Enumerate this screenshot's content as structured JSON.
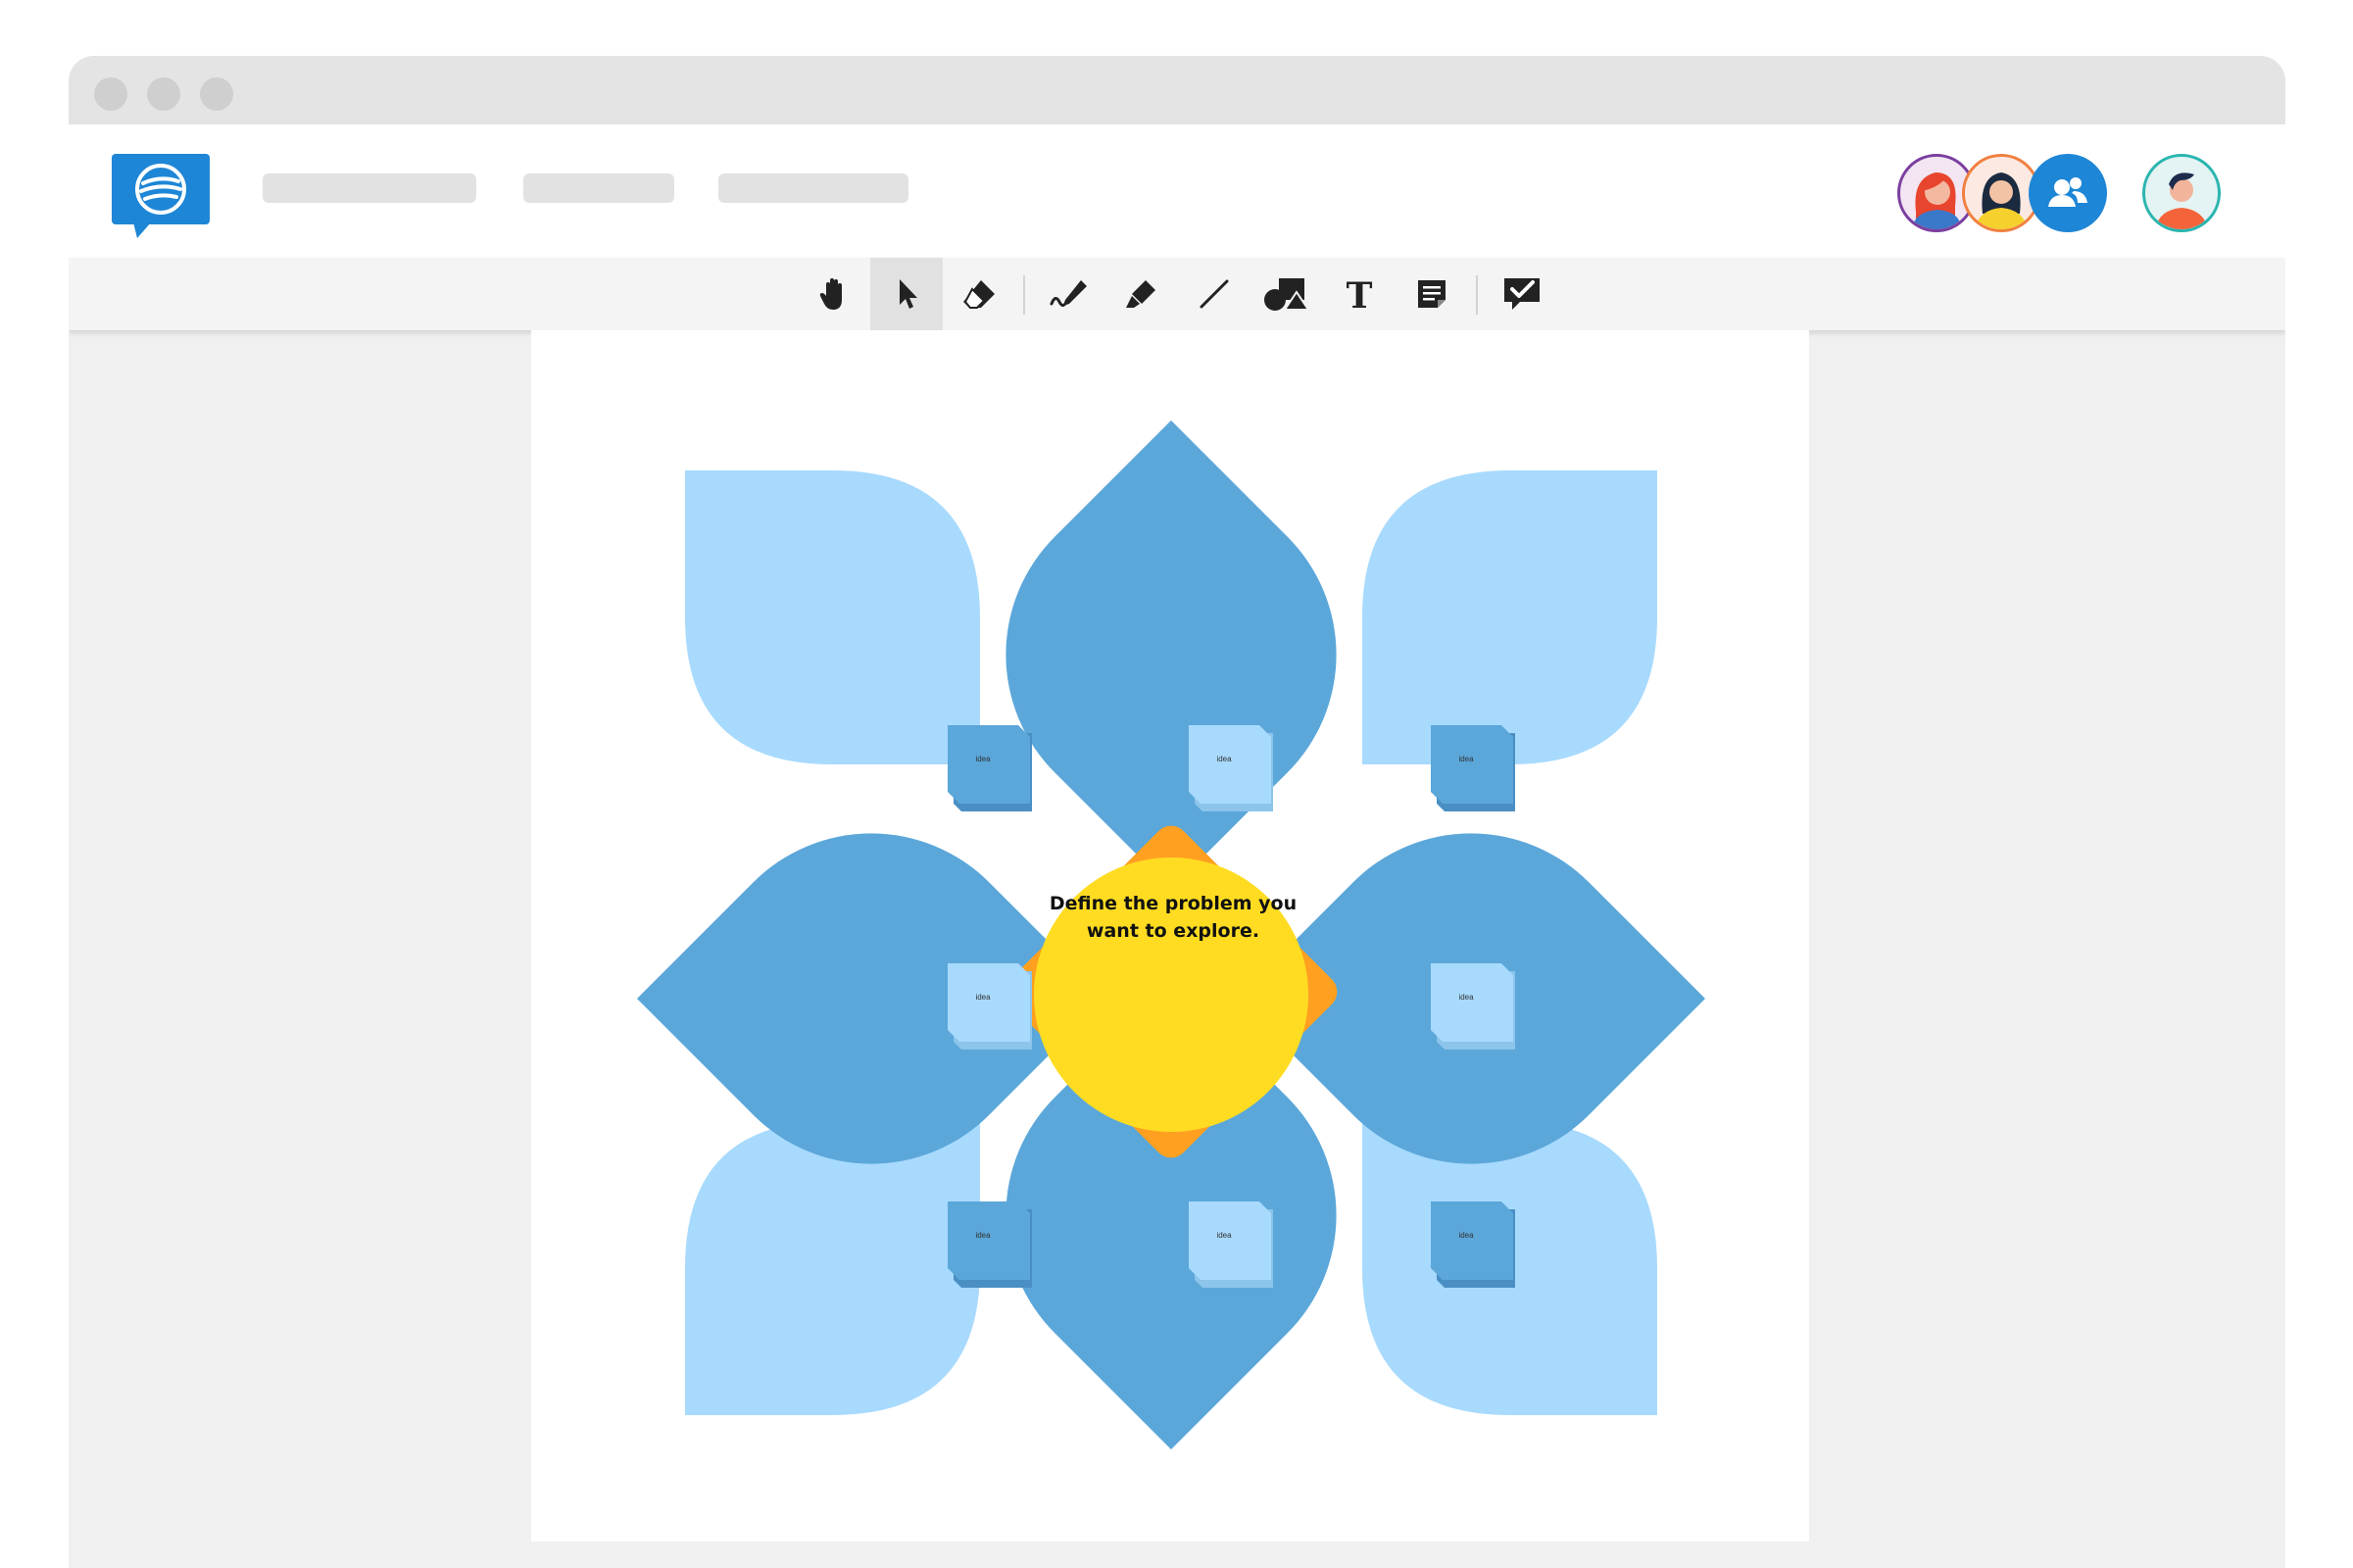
{
  "app": {
    "brand_color": "#1e86d6",
    "logo_icon": "chat-bubble-logo-icon"
  },
  "collaborators": [
    {
      "name": "collaborator-avatar-1",
      "ring": "#7b3fa0"
    },
    {
      "name": "collaborator-avatar-2",
      "ring": "#f08040"
    },
    {
      "name": "participants-icon",
      "ring": "#1e86d6"
    },
    {
      "name": "current-user-avatar",
      "ring": "#2bb5b0"
    }
  ],
  "toolbar": {
    "tools": [
      {
        "name": "hand-tool",
        "icon": "hand-icon",
        "active": false
      },
      {
        "name": "select-tool",
        "icon": "cursor-arrow-icon",
        "active": true
      },
      {
        "name": "eraser-tool",
        "icon": "eraser-icon",
        "active": false
      },
      {
        "name": "pen-tool",
        "icon": "pen-icon",
        "active": false
      },
      {
        "name": "highlighter-tool",
        "icon": "highlighter-icon",
        "active": false
      },
      {
        "name": "line-tool",
        "icon": "line-icon",
        "active": false
      },
      {
        "name": "shapes-tool",
        "icon": "shapes-icon",
        "active": false
      },
      {
        "name": "text-tool",
        "icon": "text-icon",
        "active": false
      },
      {
        "name": "sticky-note-tool",
        "icon": "sticky-note-icon",
        "active": false
      },
      {
        "name": "feedback-tool",
        "icon": "comment-check-icon",
        "active": false
      }
    ]
  },
  "board": {
    "center_text_line1": "Define the problem you",
    "center_text_line2": "want to explore.",
    "colors": {
      "petal_dark": "#5ba7da",
      "petal_light": "#a8dafd",
      "diamond": "#ffa020",
      "center": "#ffdc22"
    },
    "stickies": [
      {
        "label": "idea",
        "style": "dark"
      },
      {
        "label": "idea",
        "style": "light"
      },
      {
        "label": "idea",
        "style": "dark"
      },
      {
        "label": "idea",
        "style": "light"
      },
      {
        "label": "idea",
        "style": "light"
      },
      {
        "label": "idea",
        "style": "dark"
      },
      {
        "label": "idea",
        "style": "light"
      },
      {
        "label": "idea",
        "style": "dark"
      }
    ]
  }
}
